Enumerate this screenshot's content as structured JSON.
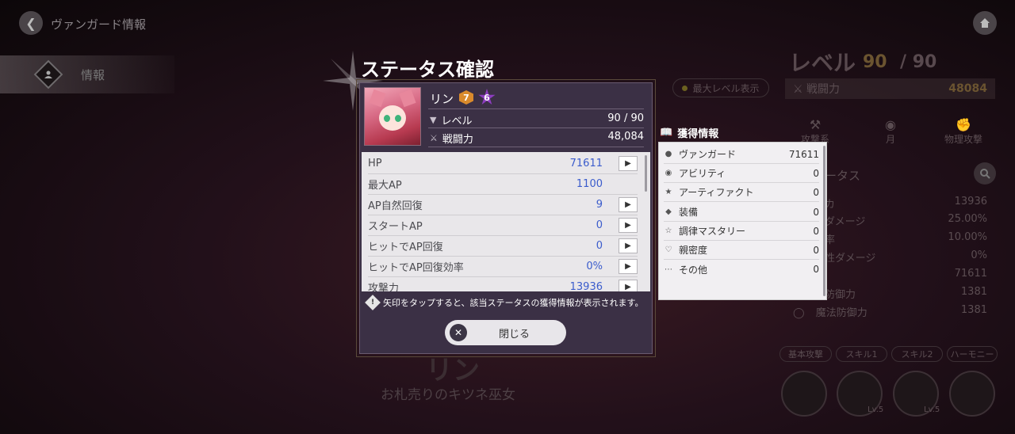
{
  "topbar": {
    "title": "ヴァンガード情報",
    "back_icon": "back-arrow-icon",
    "home_icon": "home-icon"
  },
  "sidebar": {
    "items": [
      {
        "label": "情報",
        "icon": "person-icon"
      }
    ]
  },
  "background": {
    "level_label": "レベル",
    "level_value": "90",
    "level_max": "/ 90",
    "max_level_toggle": "最大レベル表示",
    "power_label": "戦闘力",
    "power_value": "48084",
    "attributes": [
      "攻撃系",
      "月",
      "物理攻撃"
    ],
    "status_header": "ータス",
    "stats": [
      {
        "label": "カ",
        "value": "13936"
      },
      {
        "label": "ダメージ",
        "value": "25.00%"
      },
      {
        "label": "率",
        "value": "10.00%"
      },
      {
        "label": "性ダメージ",
        "value": "0%"
      },
      {
        "label": "",
        "value": "71611"
      },
      {
        "label": "防御力",
        "value": "1381"
      },
      {
        "label": "魔法防御力",
        "value": "1381"
      }
    ],
    "skill_tabs": [
      "基本攻撃",
      "スキル1",
      "スキル2",
      "ハーモニー"
    ],
    "skill_levels": [
      "Lv.5",
      "Lv.5"
    ],
    "character_name": "リン",
    "character_title": "お札売りのキツネ巫女"
  },
  "modal": {
    "title": "ステータス確認",
    "character": {
      "name": "リン",
      "rank_badge": "7",
      "star_badge": "6",
      "level_label": "レベル",
      "level_value": "90 / 90",
      "power_label": "戦闘力",
      "power_value": "48,084"
    },
    "stats": [
      {
        "label": "HP",
        "value": "71611",
        "has_arrow": true
      },
      {
        "label": "最大AP",
        "value": "1100",
        "has_arrow": false
      },
      {
        "label": "AP自然回復",
        "value": "9",
        "has_arrow": true
      },
      {
        "label": "スタートAP",
        "value": "0",
        "has_arrow": true
      },
      {
        "label": "ヒットでAP回復",
        "value": "0",
        "has_arrow": true
      },
      {
        "label": "ヒットでAP回復効率",
        "value": "0%",
        "has_arrow": true
      },
      {
        "label": "攻撃力",
        "value": "13936",
        "has_arrow": true
      }
    ],
    "hint": "矢印をタップすると、該当ステータスの獲得情報が表示されます。",
    "close_label": "閉じる"
  },
  "acquisition": {
    "title": "獲得情報",
    "rows": [
      {
        "label": "ヴァンガード",
        "value": "71611",
        "icon": "person-icon"
      },
      {
        "label": "アビリティ",
        "value": "0",
        "icon": "ability-icon"
      },
      {
        "label": "アーティファクト",
        "value": "0",
        "icon": "artifact-icon"
      },
      {
        "label": "装備",
        "value": "0",
        "icon": "equipment-icon"
      },
      {
        "label": "調律マスタリー",
        "value": "0",
        "icon": "mastery-icon"
      },
      {
        "label": "親密度",
        "value": "0",
        "icon": "heart-icon"
      },
      {
        "label": "その他",
        "value": "0",
        "icon": "more-icon"
      }
    ]
  }
}
